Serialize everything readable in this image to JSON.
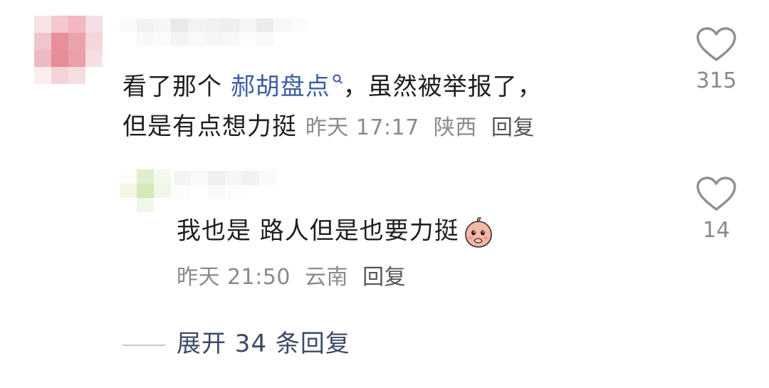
{
  "comment": {
    "avatar_colors": [
      "#f6e3e6",
      "#f3c8cf",
      "#f2b7c0",
      "#f6dde1",
      "#f0c5cc",
      "#e7909c",
      "#e9a3ad",
      "#f3d6da",
      "#efb9c1",
      "#e58d99",
      "#ea9faa",
      "#f6dfe2",
      "#fbeef0",
      "#f3d3d8",
      "#f5dde1",
      "#ffffff"
    ],
    "username_colors": [
      "#fafafa",
      "#f2f2f2",
      "#f6f6f6",
      "#e9e9e9",
      "#f3f3f3",
      "#f1f1f1",
      "#eeeeee",
      "#f5f5f5",
      "#ececec",
      "#f7f7f7",
      "#fbfbfb",
      "#ffffff",
      "#f8f8f8",
      "#fbfbfb",
      "#f4f4f4",
      "#f9f9f9",
      "#f6f6f6",
      "#f8f8f8",
      "#fcfcfc",
      "#f9f9f9",
      "#ffffff",
      "#ffffff"
    ],
    "text_part1": "看了那个 ",
    "link_text": "郝胡盘点",
    "text_part2": "，虽然被举报了，",
    "line2": "但是有点想力挺",
    "time": "昨天 17:17",
    "location": "陕西",
    "reply_label": "回复",
    "likes": "315"
  },
  "reply": {
    "avatar_colors": [
      "#fbfdf6",
      "#dfeecf",
      "#f4f9ee",
      "#f3f8e6",
      "#d4e8b8",
      "#f0f6e8",
      "#ffffff",
      "#f1f6ea",
      "#ffffff"
    ],
    "username_colors": [
      "#f4f4f4",
      "#f9f9f9",
      "#f0f0f0",
      "#f6f6f6",
      "#f2f2f2",
      "#fafafa",
      "#fcfcfc",
      "#ffffff",
      "#f8f8f8",
      "#fdfdfd",
      "#ffffff",
      "#ffffff"
    ],
    "text": "我也是 路人但是也要力挺",
    "emoji": "peach-face-emoji",
    "time": "昨天 21:50",
    "location": "云南",
    "reply_label": "回复",
    "likes": "14"
  },
  "expand_label": "展开 34 条回复"
}
